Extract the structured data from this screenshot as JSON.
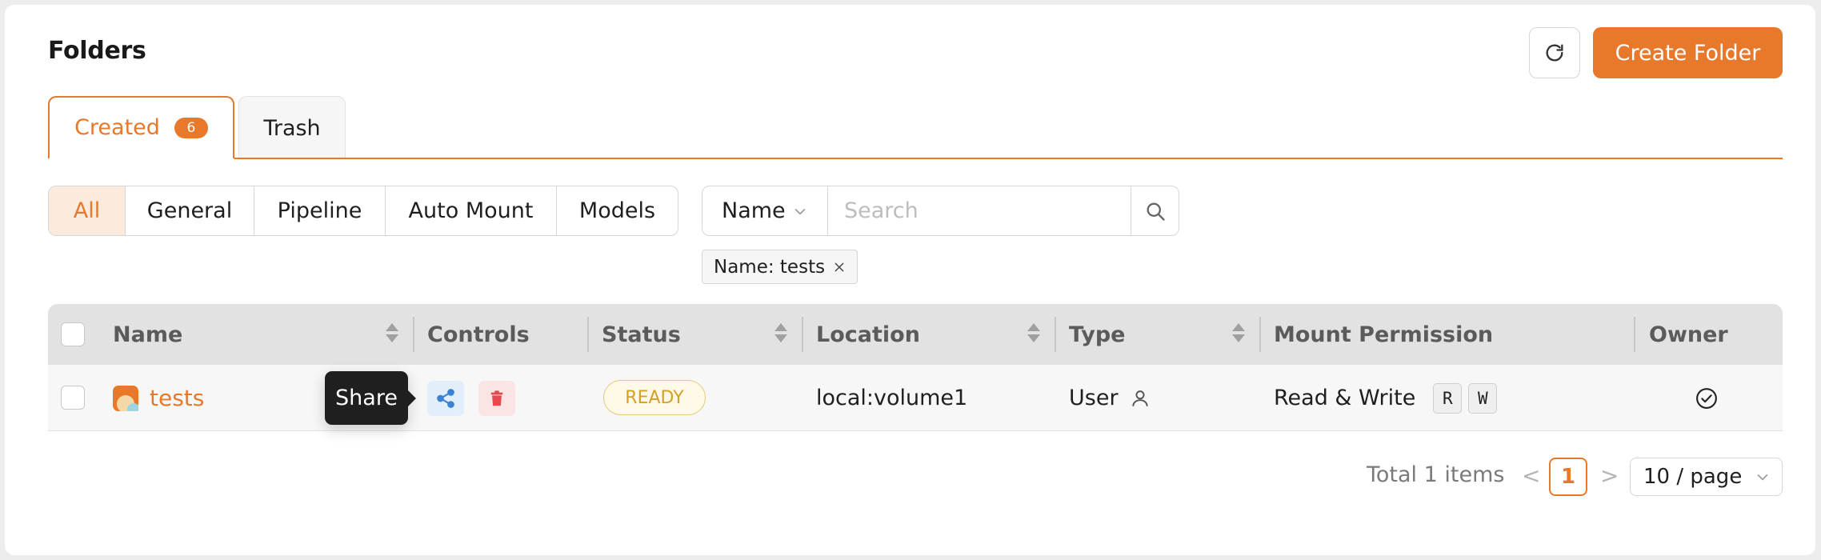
{
  "page": {
    "title": "Folders"
  },
  "toolbar": {
    "create_label": "Create Folder"
  },
  "tabs": [
    {
      "label": "Created",
      "badge": "6",
      "active": true
    },
    {
      "label": "Trash",
      "active": false
    }
  ],
  "filters": {
    "segments": [
      "All",
      "General",
      "Pipeline",
      "Auto Mount",
      "Models"
    ],
    "active": "All"
  },
  "search": {
    "field": "Name",
    "placeholder": "Search",
    "active_tag": "Name: tests"
  },
  "table": {
    "columns": [
      "Name",
      "Controls",
      "Status",
      "Location",
      "Type",
      "Mount Permission",
      "Owner"
    ],
    "rows": [
      {
        "name": "tests",
        "status": "READY",
        "location": "local:volume1",
        "type": "User",
        "permission": "Read & Write",
        "perm_flags": [
          "R",
          "W"
        ]
      }
    ]
  },
  "tooltip": {
    "text": "Share"
  },
  "pagination": {
    "total": "Total 1 items",
    "current": "1",
    "prev": "<",
    "next": ">",
    "page_size": "10 / page"
  },
  "colors": {
    "accent": "#e8782a",
    "ready": "#d4a028",
    "share": "#3b82d6",
    "delete": "#e5484d"
  }
}
